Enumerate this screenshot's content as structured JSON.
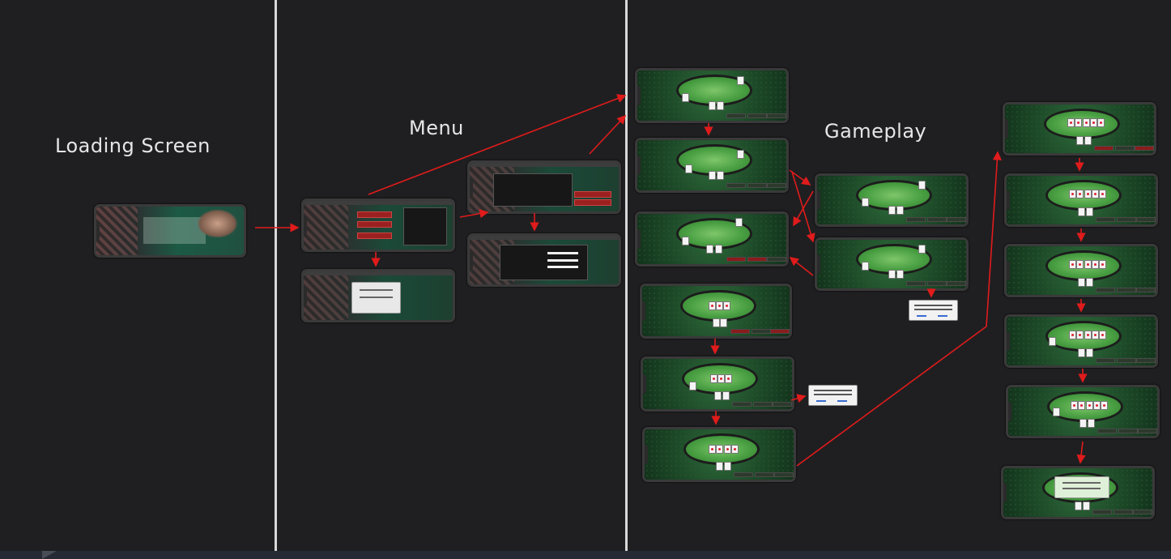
{
  "sections": {
    "loading": {
      "title": "Loading Screen"
    },
    "menu": {
      "title": "Menu"
    },
    "gameplay": {
      "title": "Gameplay"
    }
  },
  "colors": {
    "background": "#1f1f21",
    "arrow": "#e01b1b",
    "divider": "#d8d8d8",
    "title_text": "#e6e6e6"
  }
}
